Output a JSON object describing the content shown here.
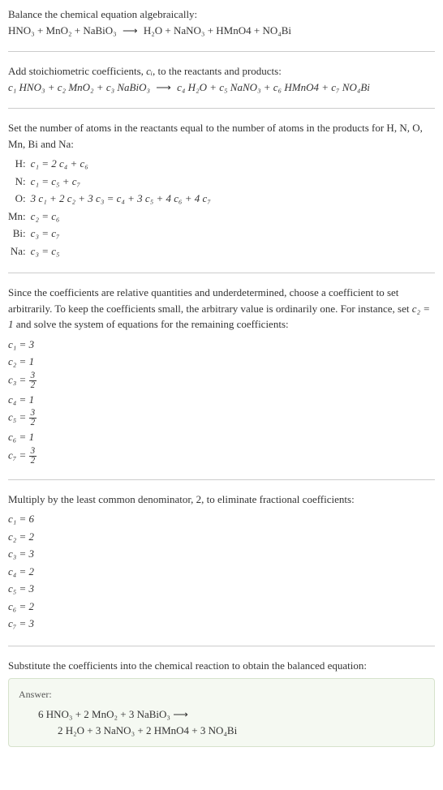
{
  "section1": {
    "title": "Balance the chemical equation algebraically:",
    "equation_lhs": "HNO₃ + MnO₂ + NaBiO₃",
    "arrow": "⟶",
    "equation_rhs": "H₂O + NaNO₃ + HMnO4 + NO₄Bi"
  },
  "section2": {
    "title_part1": "Add stoichiometric coefficients, ",
    "title_ci": "cᵢ",
    "title_part2": ", to the reactants and products:",
    "eq_lhs1": "c₁ HNO₃ + c₂ MnO₂ + c₃ NaBiO₃",
    "arrow": "⟶",
    "eq_rhs1": "c₄ H₂O + c₅ NaNO₃ + c₆ HMnO4 + c₇ NO₄Bi"
  },
  "section3": {
    "intro": "Set the number of atoms in the reactants equal to the number of atoms in the products for H, N, O, Mn, Bi and Na:",
    "rows": [
      {
        "label": "H:",
        "eq": "c₁ = 2 c₄ + c₆"
      },
      {
        "label": "N:",
        "eq": "c₁ = c₅ + c₇"
      },
      {
        "label": "O:",
        "eq": "3 c₁ + 2 c₂ + 3 c₃ = c₄ + 3 c₅ + 4 c₆ + 4 c₇"
      },
      {
        "label": "Mn:",
        "eq": "c₂ = c₆"
      },
      {
        "label": "Bi:",
        "eq": "c₃ = c₇"
      },
      {
        "label": "Na:",
        "eq": "c₃ = c₅"
      }
    ]
  },
  "section4": {
    "intro_part1": "Since the coefficients are relative quantities and underdetermined, choose a coefficient to set arbitrarily. To keep the coefficients small, the arbitrary value is ordinarily one. For instance, set ",
    "intro_set": "c₂ = 1",
    "intro_part2": " and solve the system of equations for the remaining coefficients:",
    "coeffs": [
      {
        "lhs": "c₁ =",
        "val": "3",
        "frac": false
      },
      {
        "lhs": "c₂ =",
        "val": "1",
        "frac": false
      },
      {
        "lhs": "c₃ =",
        "num": "3",
        "den": "2",
        "frac": true
      },
      {
        "lhs": "c₄ =",
        "val": "1",
        "frac": false
      },
      {
        "lhs": "c₅ =",
        "num": "3",
        "den": "2",
        "frac": true
      },
      {
        "lhs": "c₆ =",
        "val": "1",
        "frac": false
      },
      {
        "lhs": "c₇ =",
        "num": "3",
        "den": "2",
        "frac": true
      }
    ]
  },
  "section5": {
    "intro": "Multiply by the least common denominator, 2, to eliminate fractional coefficients:",
    "coeffs": [
      "c₁ = 6",
      "c₂ = 2",
      "c₃ = 3",
      "c₄ = 2",
      "c₅ = 3",
      "c₆ = 2",
      "c₇ = 3"
    ]
  },
  "section6": {
    "intro": "Substitute the coefficients into the chemical reaction to obtain the balanced equation:"
  },
  "answer": {
    "label": "Answer:",
    "line1": "6 HNO₃ + 2 MnO₂ + 3 NaBiO₃  ⟶",
    "line2": "2 H₂O + 3 NaNO₃ + 2 HMnO4 + 3 NO₄Bi"
  }
}
